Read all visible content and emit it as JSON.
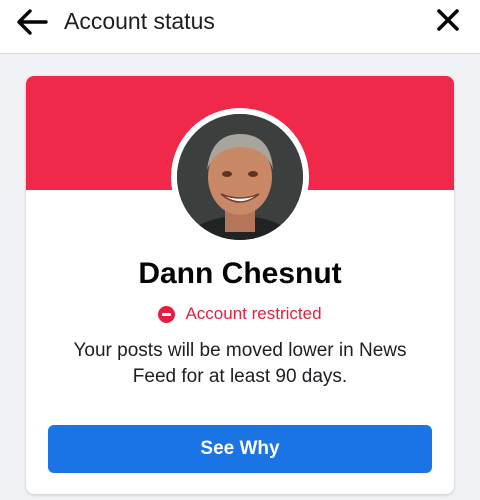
{
  "header": {
    "back_icon": "arrow-left-icon",
    "title": "Account status",
    "close_icon": "close-icon"
  },
  "profile": {
    "name": "Dann Chesnut",
    "avatar_icon": "profile-photo"
  },
  "status": {
    "icon": "minus-circle-icon",
    "label": "Account restricted",
    "color": "#e41e3f"
  },
  "message": "Your posts will be moved lower in News Feed for at least 90 days.",
  "action": {
    "label": "See Why",
    "color": "#1b74e4"
  },
  "colors": {
    "banner": "#f02849",
    "background": "#f0f2f5"
  }
}
